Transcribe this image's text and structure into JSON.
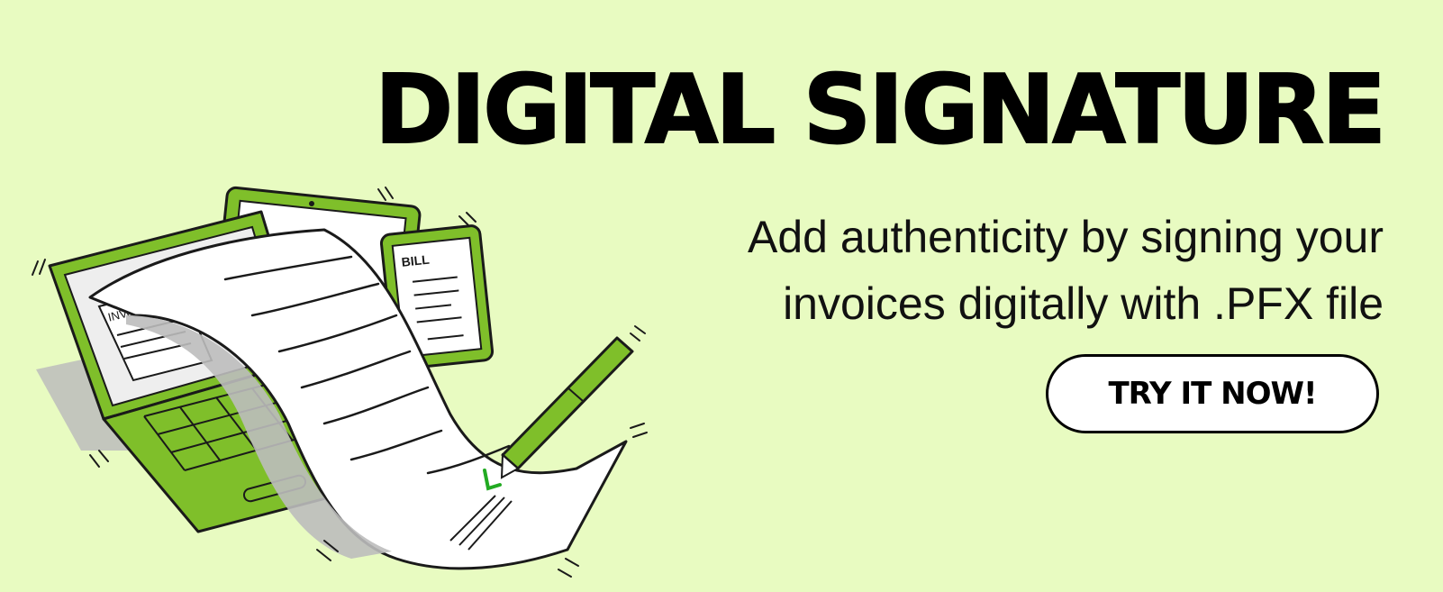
{
  "headline": "DIGITAL SIGNATURE",
  "subtitle": {
    "line1": "Add authenticity by signing your",
    "line2": "invoices digitally with .PFX file"
  },
  "cta": {
    "label": "TRY IT NOW!"
  },
  "illustration": {
    "invoice_label": "INVoice",
    "bill_label": "BILL"
  },
  "colors": {
    "background": "#e8fbc1",
    "device_green": "#7fbf2a",
    "text": "#000000",
    "button_bg": "#ffffff"
  },
  "icons": [
    "laptop-icon",
    "tablet-icon",
    "phone-icon",
    "document-icon",
    "pen-icon",
    "signature-check-icon"
  ]
}
